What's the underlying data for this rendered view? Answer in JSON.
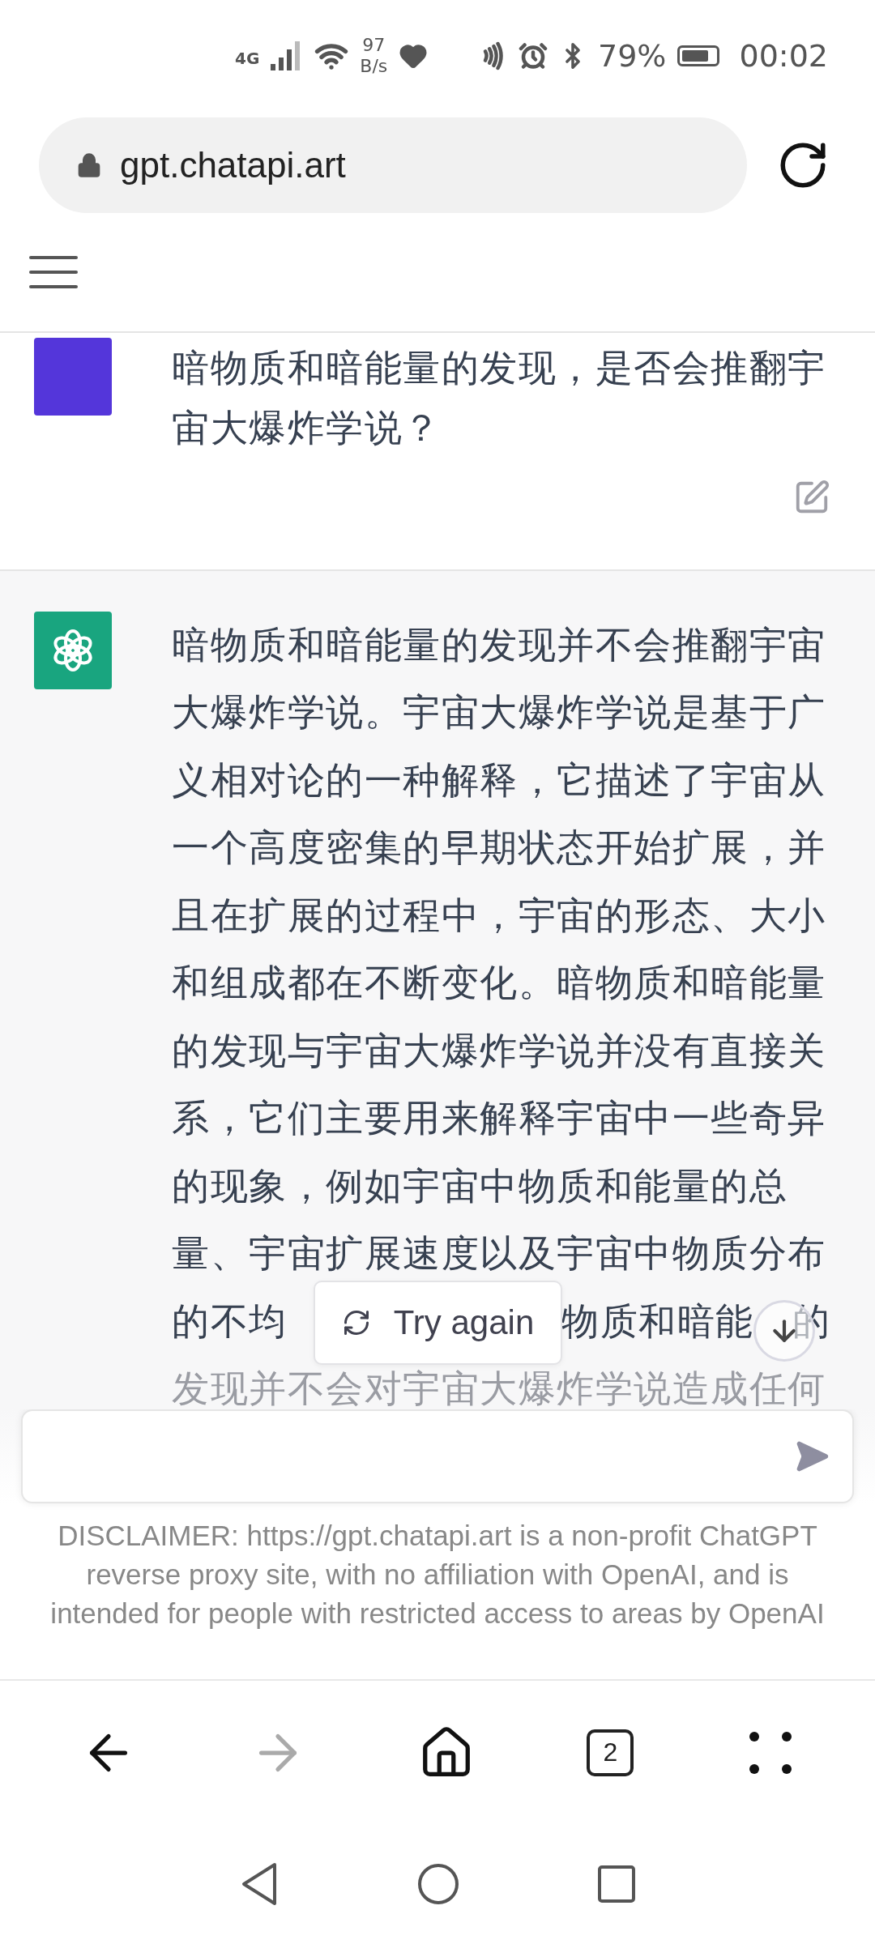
{
  "status_bar": {
    "network": "4G",
    "speed_value": "97",
    "speed_unit": "B/s",
    "battery": "79%",
    "time": "00:02"
  },
  "address_bar": {
    "url": "gpt.chatapi.art"
  },
  "messages": [
    {
      "kind": "user",
      "lines": [
        {
          "text": "暗物质和暗能量的发现，是否会推翻宇"
        },
        {
          "text": "宙大爆炸学说？"
        }
      ]
    },
    {
      "kind": "assistant",
      "lines": [
        {
          "text": "暗物质和暗能量的发现并不会推翻宇宙"
        },
        {
          "text": "大爆炸学说。宇宙大爆炸学说是基于广"
        },
        {
          "text": "义相对论的一种解释，它描述了宇宙从"
        },
        {
          "text": "一个高度密集的早期状态开始扩展，并"
        },
        {
          "text": "且在扩展的过程中，宇宙的形态、大小"
        },
        {
          "text": "和组成都在不断变化。暗物质和暗能量"
        },
        {
          "text": "的发现与宇宙大爆炸学说并没有直接关"
        },
        {
          "text": "系，它们主要用来解释宇宙中一些奇异"
        },
        {
          "text": "的现象，例如宇宙中物质和能量的总"
        },
        {
          "text": "量、宇宙扩展速度以及宇宙中物质分布"
        },
        {
          "parts": [
            "的不均",
            "物质和暗能",
            "的"
          ]
        },
        {
          "text": "发现并不会对宇宙大爆炸学说造成任何",
          "faded": true
        }
      ]
    }
  ],
  "try_again": "Try again",
  "disclaimer": "DISCLAIMER: https://gpt.chatapi.art is a non-profit ChatGPT reverse proxy site, with no affiliation with OpenAI, and is intended for people with restricted access to areas by OpenAI",
  "browser_nav": {
    "tab_count": "2"
  }
}
